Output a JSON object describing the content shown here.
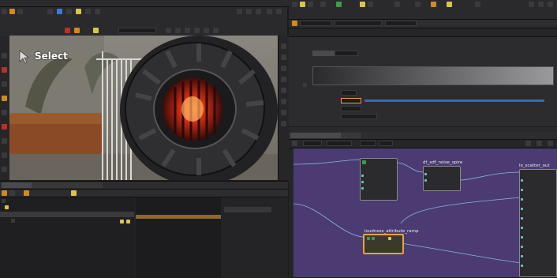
{
  "viewport": {
    "tool_label": "Select"
  },
  "network": {
    "node_a_title": "dt_sdf_noise_spire",
    "node_b_title": "loudness_attribute_ramp",
    "node_c_title": "lo_scatter_out"
  },
  "colors": {
    "accent_orange": "#d08a1e",
    "network_bg": "#4b3b72",
    "panel_bg": "#232325",
    "selection_highlight": "#e8a33a"
  }
}
